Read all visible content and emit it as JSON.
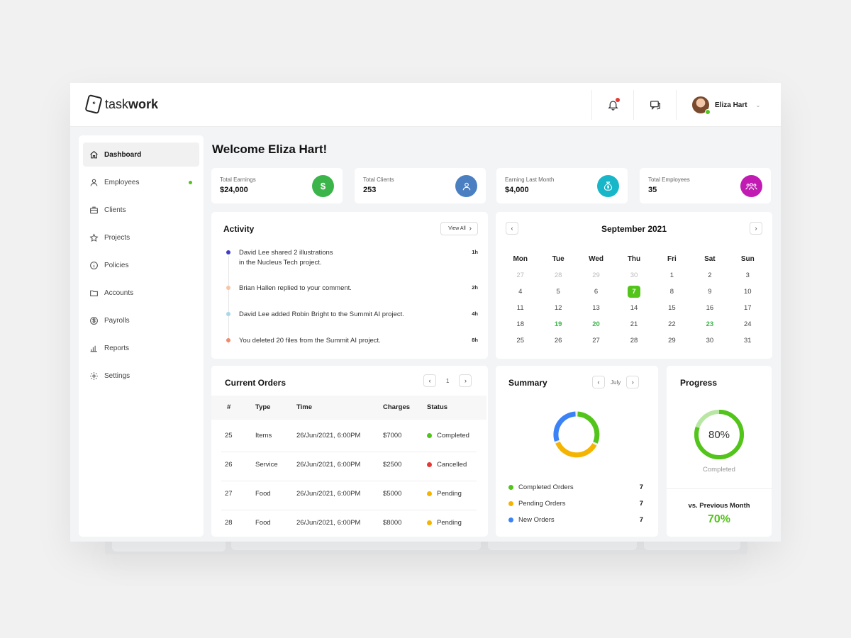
{
  "brand": {
    "name_light": "task",
    "name_bold": "work"
  },
  "user": {
    "name": "Eliza Hart"
  },
  "sidebar": {
    "items": [
      {
        "label": "Dashboard",
        "icon": "home-icon"
      },
      {
        "label": "Employees",
        "icon": "user-icon"
      },
      {
        "label": "Clients",
        "icon": "briefcase-icon"
      },
      {
        "label": "Projects",
        "icon": "star-icon"
      },
      {
        "label": "Policies",
        "icon": "info-icon"
      },
      {
        "label": "Accounts",
        "icon": "folder-icon"
      },
      {
        "label": "Payrolls",
        "icon": "dollar-icon"
      },
      {
        "label": "Reports",
        "icon": "bar-chart-icon"
      },
      {
        "label": "Settings",
        "icon": "gear-icon"
      }
    ]
  },
  "welcome": "Welcome Eliza Hart!",
  "stats": [
    {
      "label": "Total Earnings",
      "value": "$24,000",
      "icon": "dollar-icon",
      "color": "#3bb54a"
    },
    {
      "label": "Total Clients",
      "value": "253",
      "icon": "user-icon",
      "color": "#4a7fc1"
    },
    {
      "label": "Earning Last Month",
      "value": "$4,000",
      "icon": "money-bag-icon",
      "color": "#17b6c9"
    },
    {
      "label": "Total Employees",
      "value": "35",
      "icon": "group-icon",
      "color": "#c21bb4"
    }
  ],
  "activity": {
    "title": "Activity",
    "view_all": "View All",
    "items": [
      {
        "line1": "David Lee shared 2 illustrations",
        "line2": "in the Nucleus Tech project.",
        "time": "1h",
        "color": "#3f3fc5"
      },
      {
        "line1": "Brian Hallen replied to your comment.",
        "line2": "",
        "time": "2h",
        "color": "#f5c6a5"
      },
      {
        "line1": "David Lee added Robin Bright to the Summit AI project.",
        "line2": "",
        "time": "4h",
        "color": "#a9d8e8"
      },
      {
        "line1": "You deleted 20 files from the Summit AI project.",
        "line2": "",
        "time": "8h",
        "color": "#f08a6c"
      }
    ]
  },
  "calendar": {
    "title": "September 2021",
    "days": [
      "Mon",
      "Tue",
      "Wed",
      "Thu",
      "Fri",
      "Sat",
      "Sun"
    ],
    "weeks": [
      [
        "27",
        "28",
        "29",
        "30",
        "1",
        "2",
        "3"
      ],
      [
        "4",
        "5",
        "6",
        "7",
        "8",
        "9",
        "10"
      ],
      [
        "11",
        "12",
        "13",
        "14",
        "15",
        "16",
        "17"
      ],
      [
        "18",
        "19",
        "20",
        "21",
        "22",
        "23",
        "24"
      ],
      [
        "25",
        "26",
        "27",
        "28",
        "29",
        "30",
        "31"
      ]
    ],
    "muted": [
      "0-0",
      "0-1",
      "0-2",
      "0-3"
    ],
    "today": "1-3",
    "highlighted": [
      "3-1",
      "3-2",
      "3-5"
    ]
  },
  "orders": {
    "title": "Current Orders",
    "page": "1",
    "columns": [
      "#",
      "Type",
      "Time",
      "Charges",
      "Status"
    ],
    "rows": [
      {
        "id": "25",
        "type": "Items",
        "time": "26/Jun/2021, 6:00PM",
        "charges": "$7000",
        "status": "Completed",
        "color": "#52c41a"
      },
      {
        "id": "26",
        "type": "Service",
        "time": "26/Jun/2021, 6:00PM",
        "charges": "$2500",
        "status": "Cancelled",
        "color": "#e53935"
      },
      {
        "id": "27",
        "type": "Food",
        "time": "26/Jun/2021, 6:00PM",
        "charges": "$5000",
        "status": "Pending",
        "color": "#f5b400"
      },
      {
        "id": "28",
        "type": "Food",
        "time": "26/Jun/2021, 6:00PM",
        "charges": "$8000",
        "status": "Pending",
        "color": "#f5b400"
      }
    ]
  },
  "summary": {
    "title": "Summary",
    "month": "July",
    "items": [
      {
        "label": "Completed Orders",
        "count": "7",
        "color": "#52c41a"
      },
      {
        "label": "Pending Orders",
        "count": "7",
        "color": "#f5b400"
      },
      {
        "label": "New Orders",
        "count": "7",
        "color": "#3b82f6"
      }
    ]
  },
  "progress": {
    "title": "Progress",
    "percent": "80%",
    "fraction": 0.8,
    "caption": "Completed",
    "compare_label": "vs. Previous Month",
    "compare_value": "70%",
    "color": "#52c41a"
  }
}
